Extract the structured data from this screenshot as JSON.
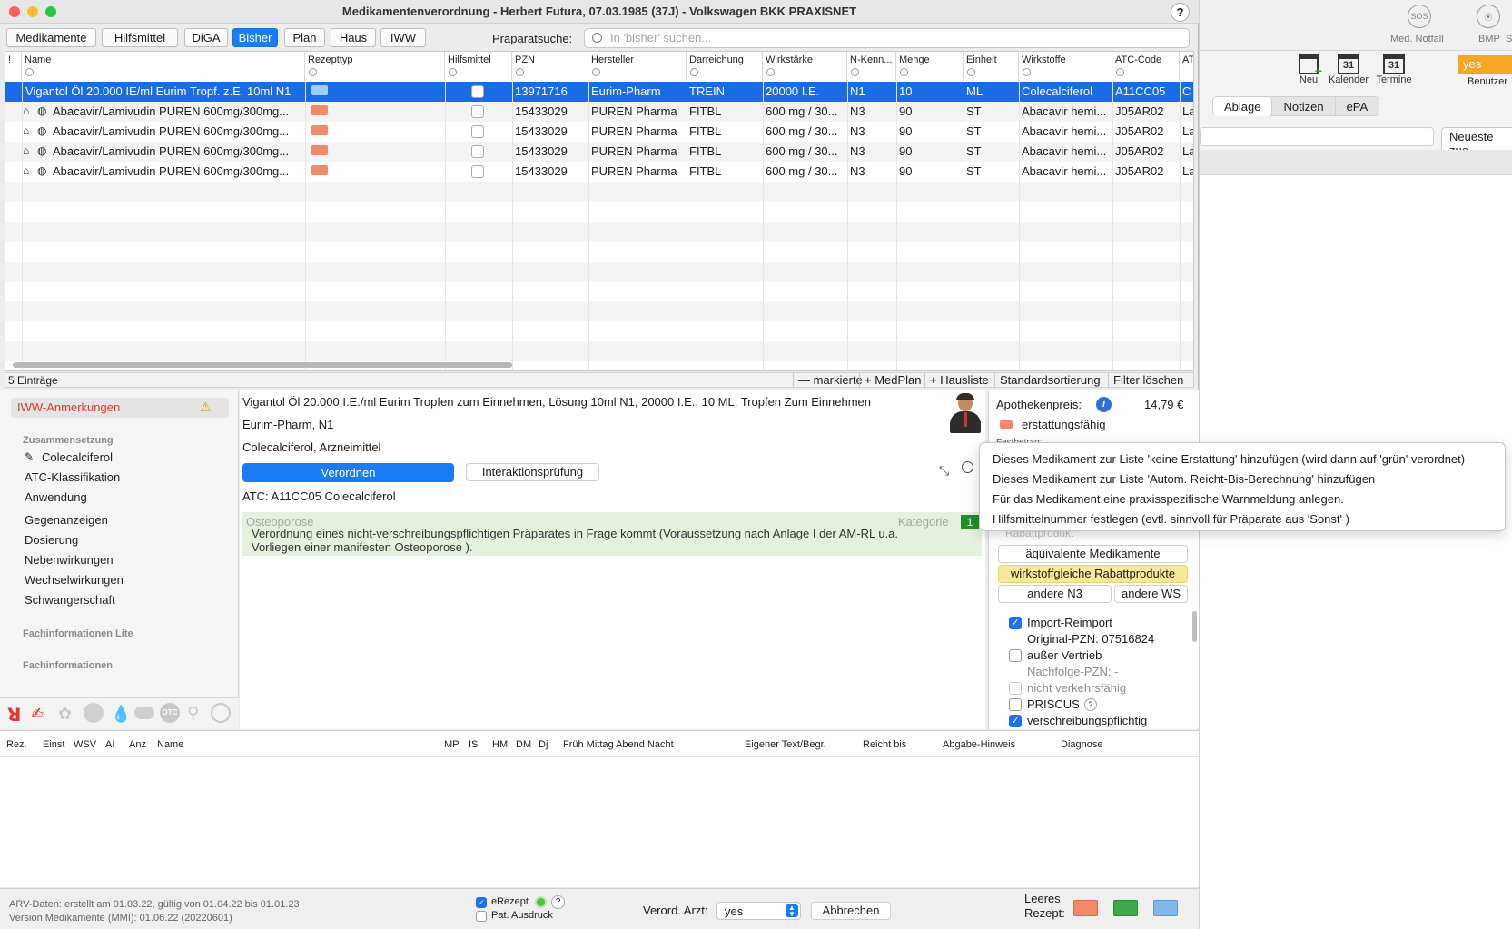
{
  "window": {
    "title": "Medikamentenverordnung - Herbert Futura, 07.03.1985 (37J) - Volkswagen BKK PRAXISNET",
    "help": "?"
  },
  "tabs": [
    {
      "label": "Medikamente"
    },
    {
      "label": "Hilfsmittel"
    },
    {
      "label": "DiGA"
    },
    {
      "label": "Bisher",
      "active": true
    },
    {
      "label": "Plan"
    },
    {
      "label": "Haus"
    },
    {
      "label": "IWW"
    }
  ],
  "search": {
    "label": "Präparatsuche:",
    "placeholder": "In 'bisher' suchen..."
  },
  "table": {
    "columns": [
      "!",
      "Name",
      "Rezepttyp",
      "Hilfsmittel",
      "PZN",
      "Hersteller",
      "Darreichung",
      "Wirkstärke",
      "N-Kenn...",
      "Menge",
      "Einheit",
      "Wirkstoffe",
      "ATC-Code",
      "AT"
    ],
    "rows": [
      {
        "name": "Vigantol Öl 20.000 IE/ml Eurim Tropf. z.E. 10ml N1",
        "pzn": "13971716",
        "hersteller": "Eurim-Pharm",
        "darreichung": "TREIN",
        "wirkstaerke": "20000 I.E.",
        "nkenn": "N1",
        "menge": "10",
        "einheit": "ML",
        "wirkstoffe": "Colecalciferol",
        "atc": "A11CC05",
        "at": "C"
      },
      {
        "name": "Abacavir/Lamivudin PUREN 600mg/300mg...",
        "pzn": "15433029",
        "hersteller": "PUREN Pharma",
        "darreichung": "FITBL",
        "wirkstaerke": "600 mg / 30...",
        "nkenn": "N3",
        "menge": "90",
        "einheit": "ST",
        "wirkstoffe": "Abacavir hemi...",
        "atc": "J05AR02",
        "at": "La"
      },
      {
        "name": "Abacavir/Lamivudin PUREN 600mg/300mg...",
        "pzn": "15433029",
        "hersteller": "PUREN Pharma",
        "darreichung": "FITBL",
        "wirkstaerke": "600 mg / 30...",
        "nkenn": "N3",
        "menge": "90",
        "einheit": "ST",
        "wirkstoffe": "Abacavir hemi...",
        "atc": "J05AR02",
        "at": "La"
      },
      {
        "name": "Abacavir/Lamivudin PUREN 600mg/300mg...",
        "pzn": "15433029",
        "hersteller": "PUREN Pharma",
        "darreichung": "FITBL",
        "wirkstaerke": "600 mg / 30...",
        "nkenn": "N3",
        "menge": "90",
        "einheit": "ST",
        "wirkstoffe": "Abacavir hemi...",
        "atc": "J05AR02",
        "at": "La"
      },
      {
        "name": "Abacavir/Lamivudin PUREN 600mg/300mg...",
        "pzn": "15433029",
        "hersteller": "PUREN Pharma",
        "darreichung": "FITBL",
        "wirkstaerke": "600 mg / 30...",
        "nkenn": "N3",
        "menge": "90",
        "einheit": "ST",
        "wirkstoffe": "Abacavir hemi...",
        "atc": "J05AR02",
        "at": "La"
      }
    ],
    "count": "5 Einträge",
    "footer_buttons": [
      "— markierte",
      "+ MedPlan",
      "+ Hausliste",
      "Standardsortierung",
      "Filter löschen"
    ]
  },
  "left_panel": {
    "iww": "IWW-Anmerkungen",
    "zusammensetzung": "Zusammensetzung",
    "items": [
      "Colecalciferol",
      "ATC-Klassifikation",
      "Anwendung",
      "Gegenanzeigen",
      "Dosierung",
      "Nebenwirkungen",
      "Wechselwirkungen",
      "Schwangerschaft"
    ],
    "fach_lite": "Fachinformationen Lite",
    "fach": "Fachinformationen"
  },
  "detail": {
    "line1": "Vigantol Öl 20.000 I.E./ml Eurim Tropfen zum Einnehmen, Lösung 10ml N1, 20000 I.E., 10 ML, Tropfen Zum Einnehmen",
    "line2": "Eurim-Pharm, N1",
    "line3": "Colecalciferol, Arzneimittel",
    "verordnen": "Verordnen",
    "interaktion": "Interaktionsprüfung",
    "atc": "ATC: A11CC05 Colecalciferol",
    "note_title": "Osteoporose",
    "note_kategorie": "Kategorie",
    "note_num": "1",
    "note_text1": "Verordnung eines nicht-verschreibungspflichtigen Präparates in Frage kommt (Voraussetzung nach Anlage I der AM-RL u.a.",
    "note_text2": "Vorliegen einer manifesten Osteoporose )."
  },
  "right_info": {
    "apothekenpreis": "Apothekenpreis:",
    "price": "14,79 €",
    "erstattung": "erstattungsfähig",
    "festbetrag": "Festbetrag:",
    "rabatt": "Rabattprodukt",
    "aequivalent": "äquivalente Medikamente",
    "wirkstoffgleich": "wirkstoffgleiche Rabattprodukte",
    "andere_n3": "andere N3",
    "andere_ws": "andere WS",
    "import": "Import-Reimport",
    "original_pzn": "Original-PZN: 07516824",
    "ausser_vertrieb": "außer Vertrieb",
    "nachfolge": "Nachfolge-PZN: -",
    "nicht_verkehr": "nicht verkehrsfähig",
    "priscus": "PRISCUS",
    "verschreibung": "verschreibungspflichtig"
  },
  "popup": [
    "Dieses Medikament zur Liste 'keine Erstattung' hinzufügen (wird dann auf 'grün' verordnet)",
    "Dieses Medikament zur Liste 'Autom. Reicht-Bis-Berechnung' hinzufügen",
    "Für das Medikament eine praxisspezifische Warnmeldung anlegen.",
    "Hilfsmittelnummer festlegen (evtl. sinnvoll für Präparate aus 'Sonst' )"
  ],
  "bottom_columns": [
    "Rez.",
    "Einst",
    "WSV",
    "AI",
    "Anz",
    "Name",
    "MP",
    "IS",
    "HM",
    "DM",
    "Dj",
    "Früh Mittag Abend Nacht",
    "Eigener Text/Begr.",
    "Reicht bis",
    "Abgabe-Hinweis",
    "Diagnose"
  ],
  "footer": {
    "arv": "ARV-Daten: erstellt am 01.03.22, gültig von 01.04.22 bis 01.01.23",
    "version": "Version Medikamente (MMI):  01.06.22 (20220601)",
    "erezept": "eRezept",
    "pat_ausdruck": "Pat. Ausdruck",
    "verord_label": "Verord. Arzt:",
    "verord_value": "yes",
    "abbrechen": "Abbrechen",
    "leeres1": "Leeres",
    "leeres2": "Rezept:"
  },
  "bg_app": {
    "sos": "SOS",
    "notfall": "Med. Notfall",
    "bmp": "BMP",
    "s": "Se",
    "neu": "Neu",
    "kalender": "Kalender",
    "termine": "Termine",
    "cal_num": "31",
    "benutzer_value": "yes",
    "benutzer": "Benutzer",
    "ablage": "Ablage",
    "notizen": "Notizen",
    "epa": "ePA",
    "neueste": "Neueste zue"
  }
}
